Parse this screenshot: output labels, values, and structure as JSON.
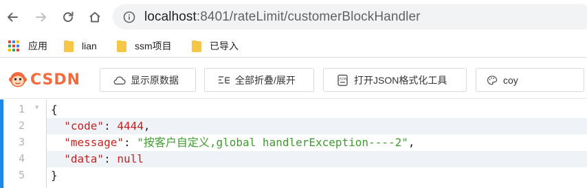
{
  "browser": {
    "url_host": "localhost",
    "url_path": ":8401/rateLimit/customerBlockHandler",
    "icons": {
      "back": "back-arrow-icon",
      "forward": "forward-arrow-icon",
      "reload": "reload-icon",
      "home": "home-icon",
      "info": "info-icon"
    }
  },
  "bookmarks": [
    {
      "label": "应用",
      "icon": "apps-grid-icon"
    },
    {
      "label": "lian",
      "icon": "folder-icon"
    },
    {
      "label": "ssm项目",
      "icon": "folder-icon"
    },
    {
      "label": "已导入",
      "icon": "folder-icon"
    }
  ],
  "extension": {
    "logo_text": "CSDN",
    "buttons": {
      "show_raw": "显示原数据",
      "fold_all": "全部折叠/展开",
      "open_json_tool": "打开JSON格式化工具"
    },
    "user": "coy",
    "brand_color": "#f26a3d"
  },
  "code": {
    "line_numbers": [
      "1",
      "2",
      "3",
      "4",
      "5"
    ],
    "open_brace": "{",
    "close_brace": "}",
    "fields": [
      {
        "key": "\"code\"",
        "value": "4444",
        "type": "number",
        "trail": ","
      },
      {
        "key": "\"message\"",
        "value": "\"按客户自定义,global handlerException----2\"",
        "type": "string",
        "trail": ","
      },
      {
        "key": "\"data\"",
        "value": "null",
        "type": "null",
        "trail": ""
      }
    ]
  }
}
